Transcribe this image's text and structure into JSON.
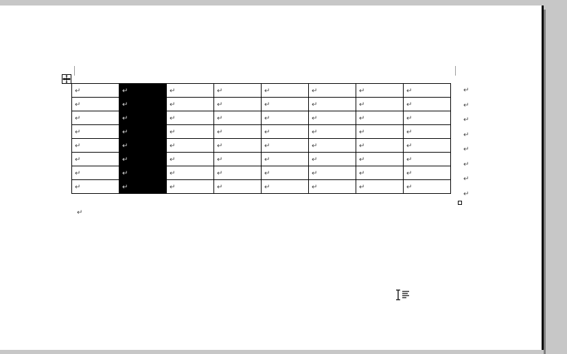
{
  "table": {
    "rows": 8,
    "cols": 8,
    "selected_column_index": 1,
    "cell_mark": "↵",
    "row_end_mark": "↵"
  },
  "trailing_paragraph_mark": "↵",
  "handles": {
    "move_handle_name": "table-move-handle",
    "resize_handle_name": "table-resize-handle"
  }
}
